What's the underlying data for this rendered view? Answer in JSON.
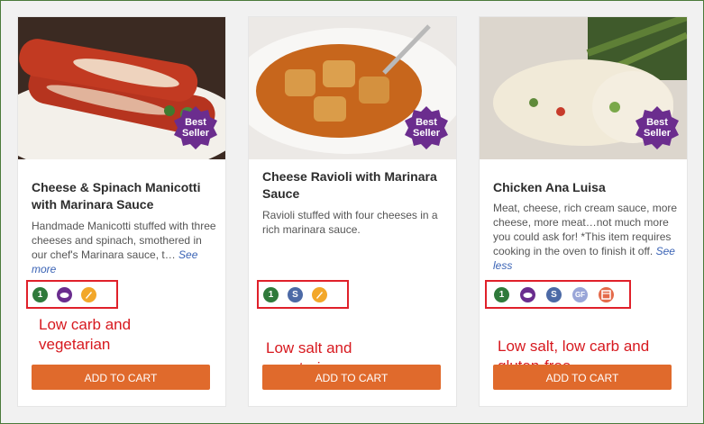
{
  "products": [
    {
      "title": "Cheese & Spinach Manicotti with Marinara Sauce",
      "description": "Handmade Manicotti stuffed with three cheeses and spinach, smothered in our chef's Marinara sauce, t…",
      "more_label": "See more",
      "badge": "Best Seller",
      "icons": [
        "one-serving-icon",
        "low-carb-icon",
        "vegetarian-icon"
      ],
      "annotation": "Low carb and vegetarian",
      "cart_label": "ADD TO CART"
    },
    {
      "title": "Cheese Ravioli with Marinara Sauce",
      "description": "Ravioli stuffed with four cheeses in a rich marinara sauce.",
      "more_label": "",
      "badge": "Best Seller",
      "icons": [
        "one-serving-icon",
        "low-salt-icon",
        "vegetarian-icon"
      ],
      "annotation": "Low salt and vegetarian",
      "cart_label": "ADD TO CART"
    },
    {
      "title": "Chicken Ana Luisa",
      "description": "Meat, cheese, rich cream sauce, more cheese, more meat…not much more you could ask for! *This item requires cooking in the oven to finish it off.",
      "more_label": "See less",
      "badge": "Best Seller",
      "icons": [
        "one-serving-icon",
        "low-carb-icon",
        "low-salt-icon",
        "gluten-free-icon",
        "oven-icon"
      ],
      "annotation": "Low salt, low carb and gluten-free",
      "cart_label": "ADD TO CART"
    }
  ],
  "icon_glyphs": {
    "one": "1",
    "salt": "S",
    "gf": "GF"
  },
  "colors": {
    "cart_button": "#e06a2c",
    "badge": "#6b2d8e",
    "annotation": "#d7191f",
    "one_serving": "#2f7a3b",
    "low_carb": "#6a2d8e",
    "vegetarian": "#f2a72a",
    "low_salt": "#4c6aa6",
    "gluten_free": "#9aa6d8",
    "oven": "#e46a4a"
  }
}
